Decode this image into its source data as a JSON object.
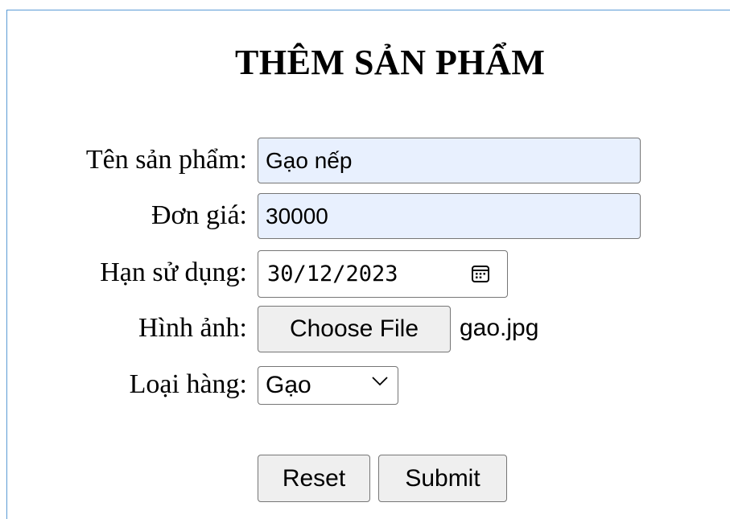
{
  "form": {
    "title": "THÊM SẢN PHẨM",
    "fields": {
      "name": {
        "label": "Tên sản phẩm:",
        "value": "Gạo nếp"
      },
      "price": {
        "label": "Đơn giá:",
        "value": "30000"
      },
      "expiry": {
        "label": "Hạn sử dụng:",
        "value": "30/12/2023",
        "icon": "calendar-icon"
      },
      "image": {
        "label": "Hình ảnh:",
        "button_label": "Choose File",
        "file_name": "gao.jpg"
      },
      "category": {
        "label": "Loại hàng:",
        "selected": "Gạo",
        "icon": "chevron-down-icon"
      }
    },
    "buttons": {
      "reset": "Reset",
      "submit": "Submit"
    }
  }
}
